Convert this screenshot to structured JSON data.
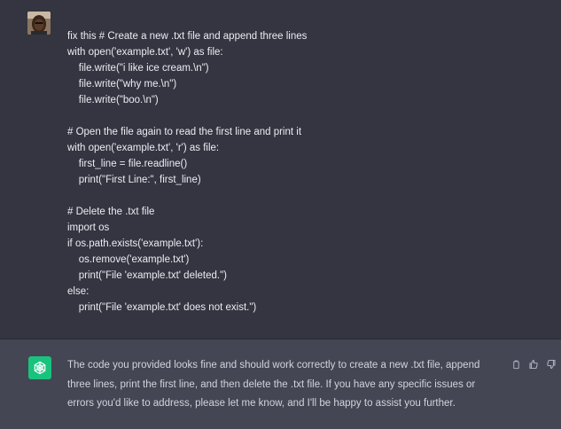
{
  "user_message": {
    "lines": [
      "fix this # Create a new .txt file and append three lines",
      "with open('example.txt', 'w') as file:",
      "    file.write(\"i like ice cream.\\n\")",
      "    file.write(\"why me.\\n\")",
      "    file.write(\"boo.\\n\")",
      "",
      "# Open the file again to read the first line and print it",
      "with open('example.txt', 'r') as file:",
      "    first_line = file.readline()",
      "    print(\"First Line:\", first_line)",
      "",
      "# Delete the .txt file",
      "import os",
      "if os.path.exists('example.txt'):",
      "    os.remove('example.txt')",
      "    print(\"File 'example.txt' deleted.\")",
      "else:",
      "    print(\"File 'example.txt' does not exist.\")"
    ]
  },
  "assistant_message": {
    "text": "The code you provided looks fine and should work correctly to create a new .txt file, append three lines, print the first line, and then delete the .txt file. If you have any specific issues or errors you'd like to address, please let me know, and I'll be happy to assist you further."
  },
  "actions": {
    "icons": [
      "copy-icon",
      "thumbs-up-icon",
      "thumbs-down-icon"
    ]
  },
  "colors": {
    "user_bg": "#343541",
    "assistant_bg": "#444654",
    "brand_green": "#19c37d"
  }
}
